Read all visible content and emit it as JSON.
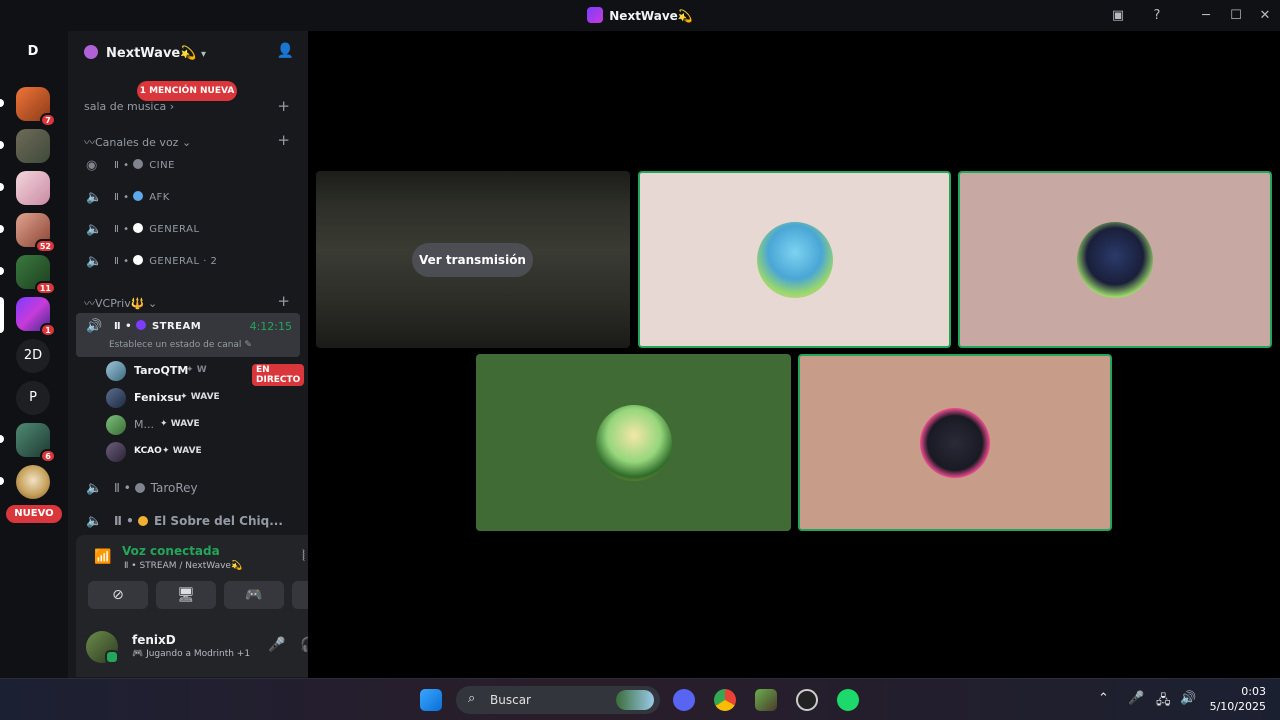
{
  "window": {
    "title": "NextWave💫"
  },
  "guild_bar": {
    "home_label": "D",
    "badges": [
      "7",
      "52",
      "11",
      "1",
      "6"
    ],
    "text_guilds": [
      "2D",
      "P"
    ],
    "new_label": "NUEVO"
  },
  "server": {
    "name": "NextWave💫",
    "mention_banner": "1 MENCIÓN NUEVA",
    "music_room": "sala de musica",
    "voice_category": "Canales de voz",
    "vcpriv_category": "VCPriv🔱",
    "channels": [
      {
        "name": "CINE"
      },
      {
        "name": "AFK"
      },
      {
        "name": "GENERAL"
      },
      {
        "name": "GENERAL · 2"
      },
      {
        "name": "STREAM"
      }
    ],
    "active": {
      "name": "STREAM",
      "timer": "4:12:15",
      "status": "Establece un estado de canal"
    },
    "users": [
      {
        "name": "TaroQTM",
        "tag": "W",
        "live": "EN DIRECTO"
      },
      {
        "name": "Fenixsu",
        "tag": "WAVE"
      },
      {
        "name": "M...",
        "tag": "WAVE"
      },
      {
        "name": "KCAO",
        "tag": "WAVE"
      }
    ],
    "extra_channels": [
      "TaroRey",
      "El Sobre del Chiq..."
    ]
  },
  "voice": {
    "title": "Voz conectada",
    "subtitle": "STREAM / NextWave💫"
  },
  "user": {
    "name": "fenixD",
    "activity": "Jugando a Modrinth +1"
  },
  "stage": {
    "watch_label": "Ver transmisión",
    "tile_colors": [
      "#e8d8d3",
      "#c8a8a2",
      "#416b35",
      "#c79d8a"
    ]
  },
  "taskbar": {
    "search_placeholder": "Buscar",
    "time": "0:03",
    "date": "5/10/2025"
  }
}
